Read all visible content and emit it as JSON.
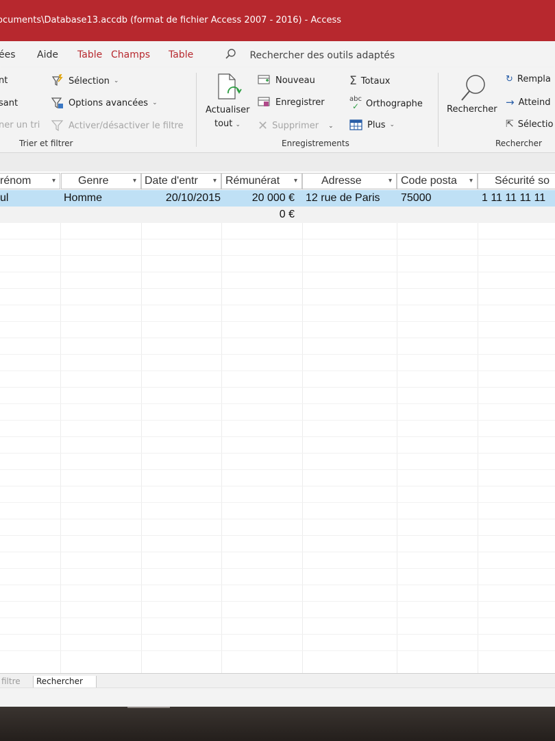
{
  "titlebar": {
    "title": "ocuments\\Database13.accdb (format de fichier Access 2007 - 2016)  -  Access"
  },
  "menu": {
    "tabs": [
      "ées",
      "Aide",
      "Table",
      "Champs",
      "Table"
    ],
    "search_placeholder": "Rechercher des outils adaptés"
  },
  "ribbon": {
    "sort_filter": {
      "item1": "nt",
      "item2": "sant",
      "item3": "ner un tri",
      "selection": "Sélection",
      "advanced": "Options avancées",
      "toggle_filter": "Activer/désactiver le filtre",
      "group_label": "Trier et filtrer"
    },
    "records": {
      "refresh_line1": "Actualiser",
      "refresh_line2": "tout",
      "new": "Nouveau",
      "save": "Enregistrer",
      "delete": "Supprimer",
      "totals": "Totaux",
      "spelling": "Orthographe",
      "more": "Plus",
      "group_label": "Enregistrements"
    },
    "find": {
      "find": "Rechercher",
      "replace": "Rempla",
      "goto": "Atteind",
      "select": "Sélectio",
      "group_label": "Rechercher"
    }
  },
  "datasheet": {
    "headers": [
      "rénom",
      "Genre",
      "Date d'entr",
      "Rémunérat",
      "Adresse",
      "Code posta",
      "Sécurité so"
    ],
    "row1": [
      "ul",
      "Homme",
      "20/10/2015",
      "20 000 €",
      "12 rue de Paris",
      "75000",
      "1 11 11 11 11"
    ],
    "row2_salary": "0 €"
  },
  "bottom_tabs": [
    "filtre",
    "Rechercher"
  ],
  "colors": {
    "title_bar": "#b7282e",
    "selected_row": "#bfe0f5",
    "context_tab": "#b7282e"
  }
}
